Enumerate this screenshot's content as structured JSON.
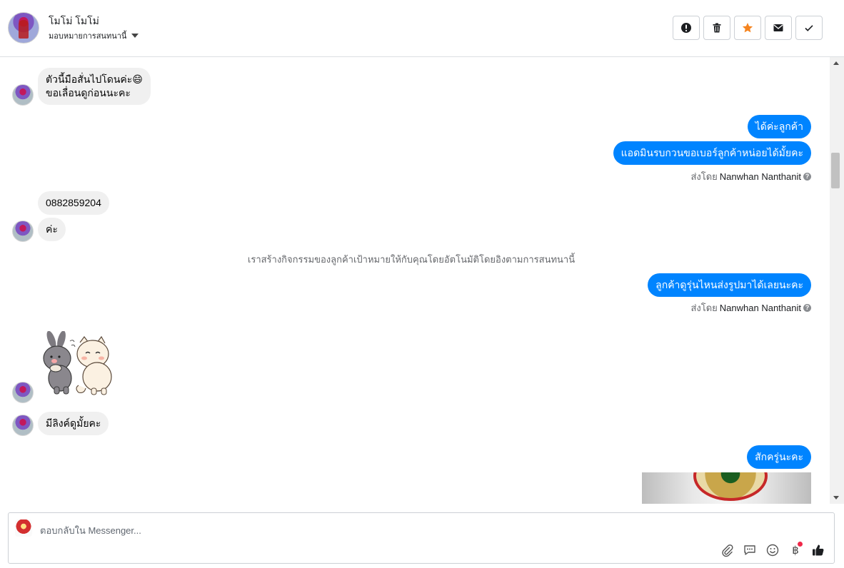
{
  "header": {
    "contact_name": "โมโม่ โมโม่",
    "assign_label": "มอบหมายการสนทนานี้",
    "actions": [
      {
        "name": "spam-button",
        "icon": "exclamation-circle-icon",
        "color": "#1c1e21"
      },
      {
        "name": "delete-button",
        "icon": "trash-icon",
        "color": "#1c1e21"
      },
      {
        "name": "star-button",
        "icon": "star-icon",
        "color": "#f5841f"
      },
      {
        "name": "mark-unread-button",
        "icon": "envelope-icon",
        "color": "#1c1e21"
      },
      {
        "name": "mark-done-button",
        "icon": "checkmark-icon",
        "color": "#1c1e21"
      }
    ]
  },
  "messages": {
    "in_1_line1": "ตัวนี้มือสั่นไปโดนค่ะ😄",
    "in_1_line2": "ขอเลื่อนดูก่อนนะคะ",
    "out_1": "ได้ค่ะลูกค้า",
    "out_2": "แอดมินรบกวนขอเบอร์ลูกค้าหน่อยได้มั้ยคะ",
    "sent_by_prefix": "ส่งโดย",
    "sent_by_name": "Nanwhan Nanthanit",
    "help_glyph": "?",
    "in_2": "0882859204",
    "in_3": "ค่ะ",
    "system_note": "เราสร้างกิจกรรมของลูกค้าเป้าหมายให้กับคุณโดยอัตโนมัติโดยอิงตามการสนทนานี้",
    "out_3": "ลูกค้าดูรุ่นไหนส่งรูปมาได้เลยนะคะ",
    "in_4": "มีลิงค์ดูมั้ยคะ",
    "out_4": "สักครู่นะคะ"
  },
  "composer": {
    "placeholder": "ตอบกลับใน Messenger...",
    "tools": [
      "paperclip-icon",
      "saved-reply-icon",
      "emoji-icon",
      "baht-payment-icon",
      "thumbs-up-icon"
    ],
    "baht_glyph": "฿",
    "accent_color": "#0084ff",
    "notification_dot_color": "#f02849"
  }
}
